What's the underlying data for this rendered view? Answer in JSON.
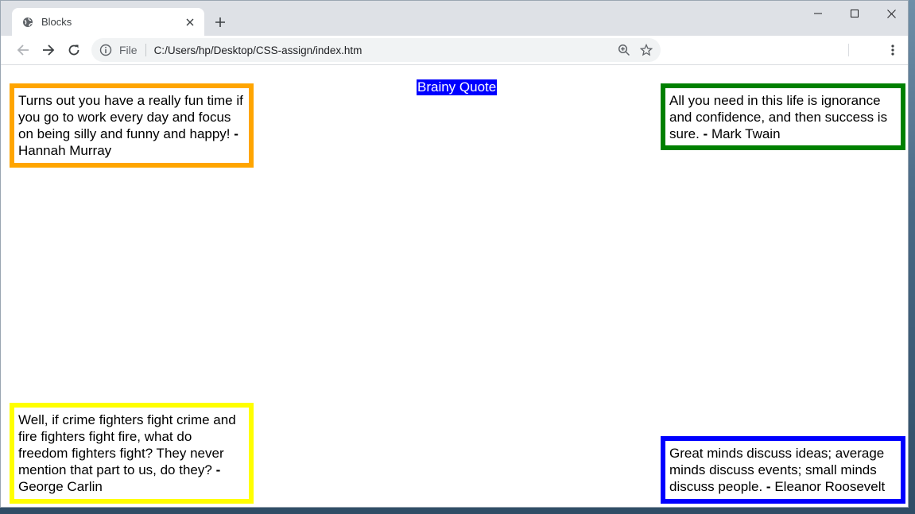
{
  "browser": {
    "tab_title": "Blocks",
    "scheme_label": "File",
    "url": "C:/Users/hp/Desktop/CSS-assign/index.htm"
  },
  "page": {
    "heading": "Brainy Quote",
    "quotes": [
      {
        "text": "Turns out you have a really fun time if you go to work every day and focus on being silly and funny and happy!",
        "author": "Hannah Murray",
        "border_color": "#ffa500"
      },
      {
        "text": "All you need in this life is ignorance and confidence, and then success is sure.",
        "author": "Mark Twain",
        "border_color": "#008000"
      },
      {
        "text": "Well, if crime fighters fight crime and fire fighters fight fire, what do freedom fighters fight? They never mention that part to us, do they?",
        "author": "George Carlin",
        "border_color": "#ffff00"
      },
      {
        "text": "Great minds discuss ideas; average minds discuss events; small minds discuss people.",
        "author": "Eleanor Roosevelt",
        "border_color": "#0000ff"
      }
    ]
  },
  "icons": {
    "tab_favicon": "globe-icon",
    "tab_close": "close-icon",
    "new_tab": "plus-icon",
    "back": "arrow-left-icon",
    "forward": "arrow-right-icon",
    "reload": "reload-icon",
    "site_info": "info-icon",
    "zoom": "zoom-icon",
    "bookmark": "star-icon",
    "menu": "kebab-menu-icon",
    "minimize": "minimize-icon",
    "maximize": "maximize-icon",
    "close_window": "close-window-icon"
  }
}
